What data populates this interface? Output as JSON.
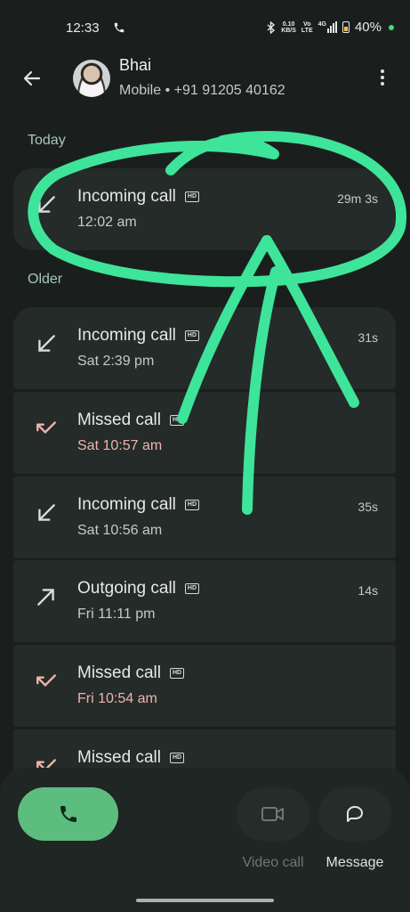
{
  "status_bar": {
    "time": "12:33",
    "net_speed_top": "0.10",
    "net_speed_unit": "KB/S",
    "volte_top": "Vo",
    "volte_bottom": "LTE",
    "network": "4G",
    "battery": "40%"
  },
  "header": {
    "name": "Bhai",
    "subtitle": "Mobile • +91 91205 40162"
  },
  "sections": {
    "today": "Today",
    "older": "Older"
  },
  "hd_label": "HD",
  "today_calls": [
    {
      "type": "Incoming call",
      "time": "12:02 am",
      "duration": "29m 3s",
      "icon": "incoming-icon",
      "hd": true
    }
  ],
  "older_calls": [
    {
      "type": "Incoming call",
      "time": "Sat 2:39 pm",
      "duration": "31s",
      "icon": "incoming-icon",
      "hd": true
    },
    {
      "type": "Missed call",
      "time": "Sat 10:57 am",
      "duration": "",
      "icon": "missed-icon",
      "hd": true
    },
    {
      "type": "Incoming call",
      "time": "Sat 10:56 am",
      "duration": "35s",
      "icon": "incoming-icon",
      "hd": true
    },
    {
      "type": "Outgoing call",
      "time": "Fri 11:11 pm",
      "duration": "14s",
      "icon": "outgoing-icon",
      "hd": true
    },
    {
      "type": "Missed call",
      "time": "Fri 10:54 am",
      "duration": "",
      "icon": "missed-icon",
      "hd": true
    },
    {
      "type": "Missed call",
      "time": "",
      "duration": "",
      "icon": "missed-icon",
      "hd": true
    }
  ],
  "actions": {
    "video_label": "Video call",
    "message_label": "Message"
  },
  "colors": {
    "background": "#1a1f1d",
    "card": "#242b28",
    "call_button": "#5dbd7e",
    "missed": "#f0b3ad",
    "annotation": "#3ee49a"
  }
}
